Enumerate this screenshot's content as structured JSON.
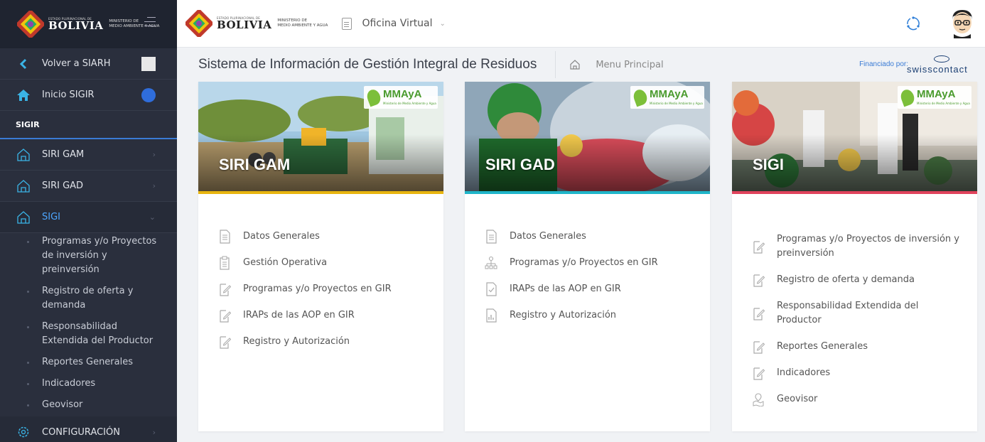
{
  "brand": {
    "small": "ESTADO PLURINACIONAL DE",
    "big": "BOLIVIA",
    "ministry_l1": "MINISTERIO DE",
    "ministry_l2": "MEDIO AMBIENTE Y AGUA"
  },
  "sidebar": {
    "back_label": "Volver a SIARH",
    "home_label": "Inicio SIGIR",
    "section": "SIGIR",
    "items": [
      {
        "label": "SIRI GAM"
      },
      {
        "label": "SIRI GAD"
      },
      {
        "label": "SIGI"
      }
    ],
    "sub_items": [
      "Programas y/o Proyectos de inversión y preinversión",
      "Registro de oferta y demanda",
      "Responsabilidad Extendida del Productor",
      "Reportes Generales",
      "Indicadores",
      "Geovisor"
    ],
    "config_label": "CONFIGURACIÓN"
  },
  "topbar": {
    "office_label": "Oficina Virtual"
  },
  "header": {
    "title": "Sistema de Información de Gestión Integral de Residuos",
    "breadcrumb": "Menu Principal",
    "financed_by": "Financiado por:",
    "sponsor": "swisscontact"
  },
  "cards": [
    {
      "title": "SIRI GAM",
      "accent": "#e8b50f",
      "items": [
        "Datos Generales",
        "Gestión Operativa",
        "Programas y/o Proyectos en GIR",
        "IRAPs de las AOP en GIR",
        "Registro y Autorización"
      ]
    },
    {
      "title": "SIRI GAD",
      "accent": "#1fb5c9",
      "items": [
        "Datos Generales",
        "Programas y/o Proyectos en GIR",
        "IRAPs de las AOP en GIR",
        "Registro y Autorización"
      ]
    },
    {
      "title": "SIGI",
      "accent": "#e0435c",
      "items": [
        "Programas y/o Proyectos de inversión y preinversión",
        "Registro de oferta y demanda",
        "Responsabilidad Extendida del Productor",
        "Reportes Generales",
        "Indicadores",
        "Geovisor"
      ]
    }
  ],
  "logo_text": {
    "mmaya": "MMAyA",
    "mmaya_sub": "Ministerio de Medio Ambiente y Agua"
  },
  "colors": {
    "sidebar_bg": "#2a2f3d",
    "active": "#4da6ff",
    "link": "#3a7bd5"
  }
}
